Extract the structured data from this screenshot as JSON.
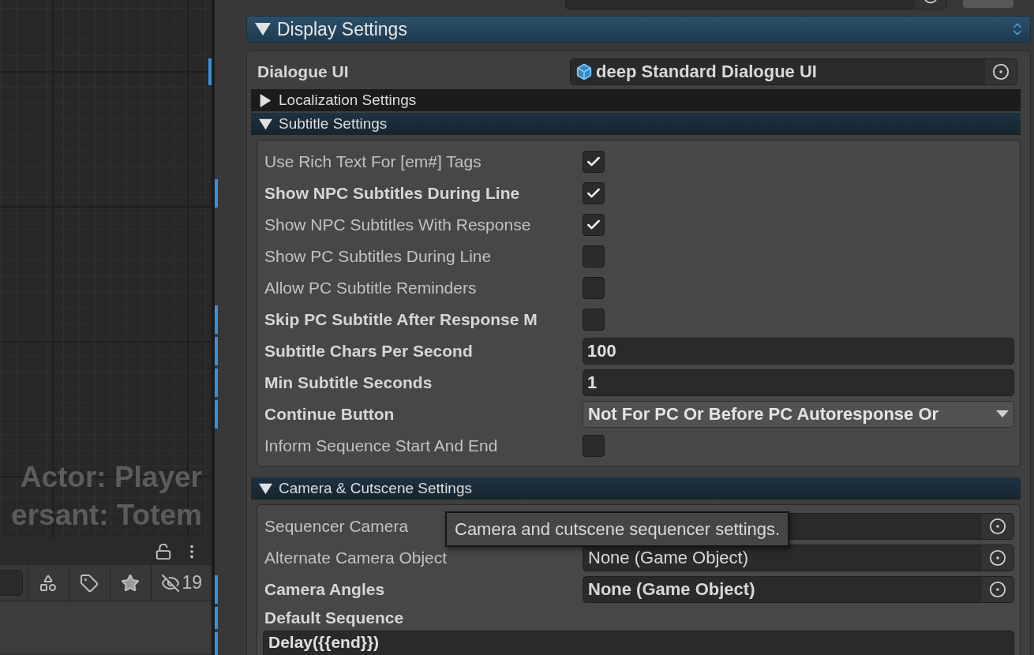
{
  "graph_panel": {
    "overlay_lines": [
      "Actor: Player",
      "ersant: Totem"
    ],
    "filter_bar": {
      "hidden_count": "19"
    }
  },
  "inspector": {
    "initial_database": {
      "kind": "object"
    },
    "display_settings": {
      "title": "Display Settings",
      "expanded": true,
      "dialogue_ui": {
        "label": "Dialogue UI",
        "value": "deep Standard Dialogue UI",
        "overridden": true
      },
      "foldouts": [
        {
          "title": "Localization Settings",
          "expanded": false
        },
        {
          "title": "Subtitle Settings",
          "expanded": true,
          "rows": [
            {
              "kind": "checkbox",
              "label": "Use Rich Text For [em#] Tags",
              "overridden": false,
              "checked": true
            },
            {
              "kind": "checkbox",
              "label": "Show NPC Subtitles During Line",
              "overridden": true,
              "checked": true
            },
            {
              "kind": "checkbox",
              "label": "Show NPC Subtitles With Response",
              "overridden": false,
              "checked": true
            },
            {
              "kind": "checkbox",
              "label": "Show PC Subtitles During Line",
              "overridden": false,
              "checked": false
            },
            {
              "kind": "checkbox",
              "label": "Allow PC Subtitle Reminders",
              "overridden": false,
              "checked": false
            },
            {
              "kind": "checkbox",
              "label": "Skip PC Subtitle After Response M",
              "overridden": true,
              "checked": false
            },
            {
              "kind": "number",
              "label": "Subtitle Chars Per Second",
              "overridden": true,
              "value": "100"
            },
            {
              "kind": "number",
              "label": "Min Subtitle Seconds",
              "overridden": true,
              "value": "1"
            },
            {
              "kind": "dropdown",
              "label": "Continue Button",
              "overridden": true,
              "value": "Not For PC Or Before PC Autoresponse Or"
            },
            {
              "kind": "checkbox",
              "label": "Inform Sequence Start And End",
              "overridden": false,
              "checked": false
            }
          ]
        },
        {
          "title": "Camera & Cutscene Settings",
          "expanded": true,
          "tooltip": "Camera and cutscene sequencer settings.",
          "rows": [
            {
              "kind": "object",
              "label": "Sequencer Camera",
              "overridden": false
            },
            {
              "kind": "object",
              "label": "Alternate Camera Object",
              "overridden": false,
              "value": "None (Game Object)"
            },
            {
              "kind": "object",
              "label": "Camera Angles",
              "overridden": true,
              "value": "None (Game Object)"
            },
            {
              "kind": "heading",
              "label": "Default Sequence",
              "overridden": true
            },
            {
              "kind": "text_area",
              "overridden": true,
              "value": "Delay({{end}})"
            }
          ]
        }
      ]
    }
  }
}
